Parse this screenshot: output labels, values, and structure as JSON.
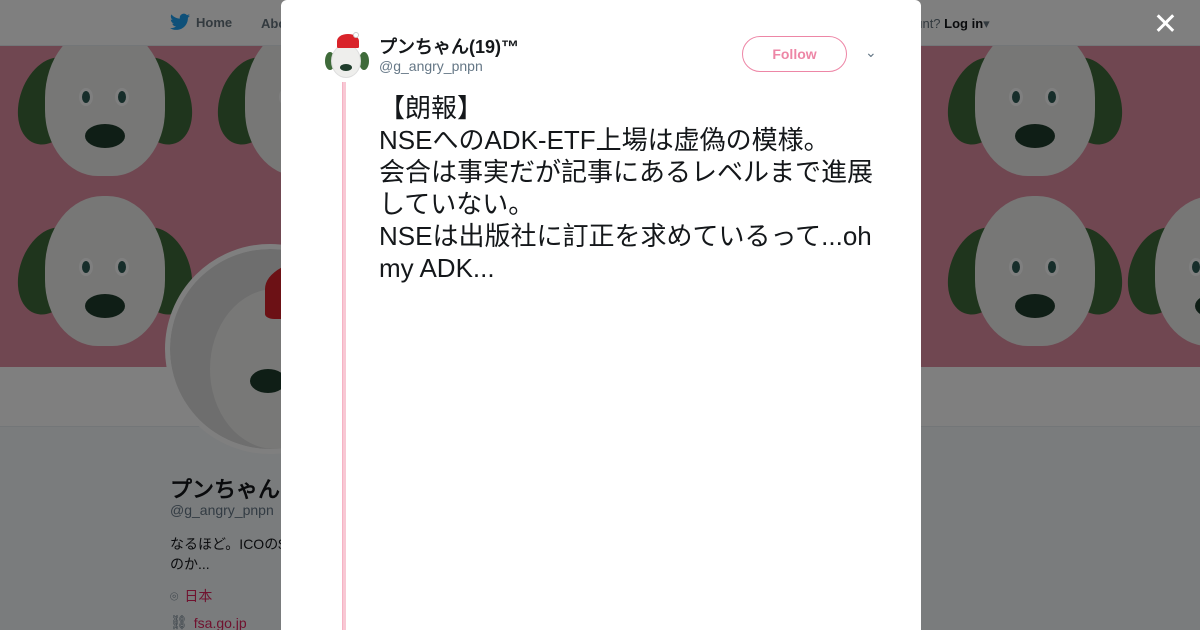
{
  "nav": {
    "home_label": "Home",
    "about_label": "Abo",
    "account_prompt": "ccount?",
    "login_label": "Log in"
  },
  "profile": {
    "name": "プンちゃん",
    "handle": "@g_angry_pnpn",
    "bio": "なるほど。ICOの$ のか...",
    "location": "日本",
    "url": "fsa.go.jp"
  },
  "tweet": {
    "author_name": "プンちゃん(19)™",
    "author_handle": "@g_angry_pnpn",
    "follow_label": "Follow",
    "text": "【朗報】\nNSEへのADK-ETF上場は虚偽の模様。\n会合は事実だが記事にあるレベルまで進展していない。\nNSEは出版社に訂正を求めているって...oh my ADK..."
  },
  "colors": {
    "accent": "#e0245e",
    "banner": "#e08ea3",
    "thread_line": "#f8c8d4"
  },
  "icons": {
    "close": "close-icon",
    "bird": "twitter-bird-icon",
    "caret": "chevron-down-icon",
    "location": "location-pin-icon",
    "link": "link-icon"
  }
}
